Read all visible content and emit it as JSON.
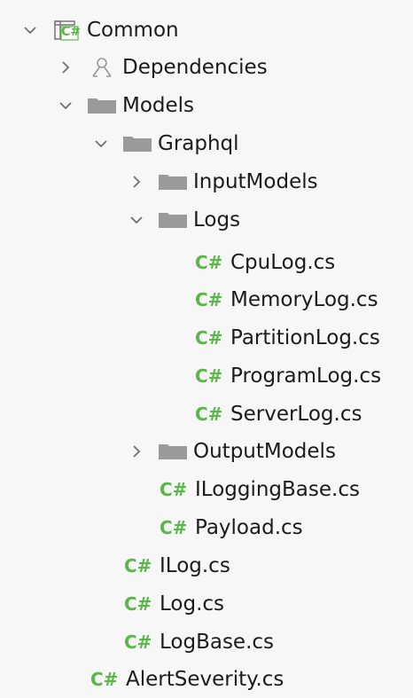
{
  "tree": {
    "project": {
      "label": "Common",
      "icon": "csharp-project-icon",
      "badge": "C#"
    },
    "items": [
      {
        "label": "Dependencies",
        "icon": "dependencies-icon",
        "expanded": false
      },
      {
        "label": "Models",
        "icon": "folder-icon",
        "expanded": true
      },
      {
        "label": "Graphql",
        "icon": "folder-icon",
        "expanded": true
      },
      {
        "label": "InputModels",
        "icon": "folder-icon",
        "expanded": false
      },
      {
        "label": "Logs",
        "icon": "folder-icon",
        "expanded": true
      },
      {
        "label": "CpuLog.cs",
        "icon": "csharp-file-icon"
      },
      {
        "label": "MemoryLog.cs",
        "icon": "csharp-file-icon"
      },
      {
        "label": "PartitionLog.cs",
        "icon": "csharp-file-icon"
      },
      {
        "label": "ProgramLog.cs",
        "icon": "csharp-file-icon"
      },
      {
        "label": "ServerLog.cs",
        "icon": "csharp-file-icon"
      },
      {
        "label": "OutputModels",
        "icon": "folder-icon",
        "expanded": false
      },
      {
        "label": "ILoggingBase.cs",
        "icon": "csharp-file-icon"
      },
      {
        "label": "Payload.cs",
        "icon": "csharp-file-icon"
      },
      {
        "label": "ILog.cs",
        "icon": "csharp-file-icon"
      },
      {
        "label": "Log.cs",
        "icon": "csharp-file-icon"
      },
      {
        "label": "LogBase.cs",
        "icon": "csharp-file-icon"
      },
      {
        "label": "AlertSeverity.cs",
        "icon": "csharp-file-icon"
      }
    ],
    "csharp_glyph": "C#"
  },
  "colors": {
    "csharp_green": "#58b847",
    "folder_gray": "#9a9a9a",
    "chevron_gray": "#6e6e6e"
  }
}
